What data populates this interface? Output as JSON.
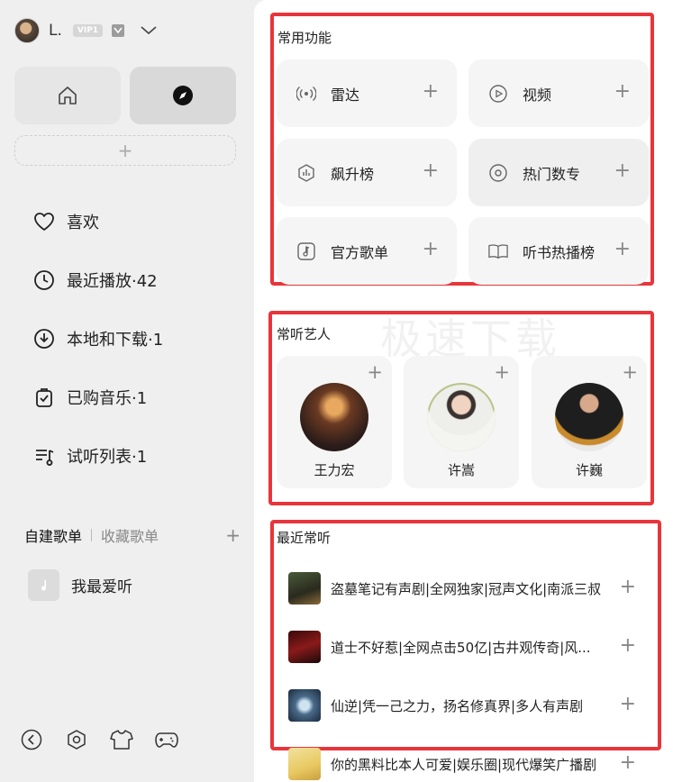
{
  "user": {
    "name": "L.",
    "vip_label": "VIP1"
  },
  "nav": {
    "add_symbol": "+"
  },
  "menu": [
    {
      "label": "喜欢",
      "icon": "heart-icon"
    },
    {
      "label": "最近播放·42",
      "icon": "clock-icon"
    },
    {
      "label": "本地和下载·1",
      "icon": "download-icon"
    },
    {
      "label": "已购音乐·1",
      "icon": "purchased-icon"
    },
    {
      "label": "试听列表·1",
      "icon": "playlist-icon"
    }
  ],
  "playlists": {
    "tab_created": "自建歌单",
    "tab_collected": "收藏歌单",
    "add_symbol": "+",
    "items": [
      {
        "name": "我最爱听"
      }
    ]
  },
  "common_functions": {
    "title": "常用功能",
    "items": [
      {
        "label": "雷达",
        "icon": "radar-icon"
      },
      {
        "label": "视频",
        "icon": "video-icon"
      },
      {
        "label": "飙升榜",
        "icon": "rising-chart-icon"
      },
      {
        "label": "热门数专",
        "icon": "disc-icon"
      },
      {
        "label": "官方歌单",
        "icon": "music-note-icon"
      },
      {
        "label": "听书热播榜",
        "icon": "book-icon"
      }
    ],
    "plus_symbol": "+"
  },
  "artists": {
    "title": "常听艺人",
    "items": [
      {
        "name": "王力宏"
      },
      {
        "name": "许嵩"
      },
      {
        "name": "许巍"
      }
    ]
  },
  "recent": {
    "title": "最近常听",
    "items": [
      {
        "title": "盗墓笔记有声剧|全网独家|冠声文化|南派三叔"
      },
      {
        "title": "道士不好惹|全网点击50亿|古井观传奇|风..."
      },
      {
        "title": "仙逆|凭一己之力，扬名修真界|多人有声剧"
      },
      {
        "title": "你的黑料比本人可爱|娱乐圈|现代爆笑广播剧"
      }
    ]
  },
  "watermark": "极速下载",
  "colors": {
    "highlight": "#e8353b",
    "sidebar_bg": "#efefef",
    "card_bg": "#f5f5f5"
  }
}
